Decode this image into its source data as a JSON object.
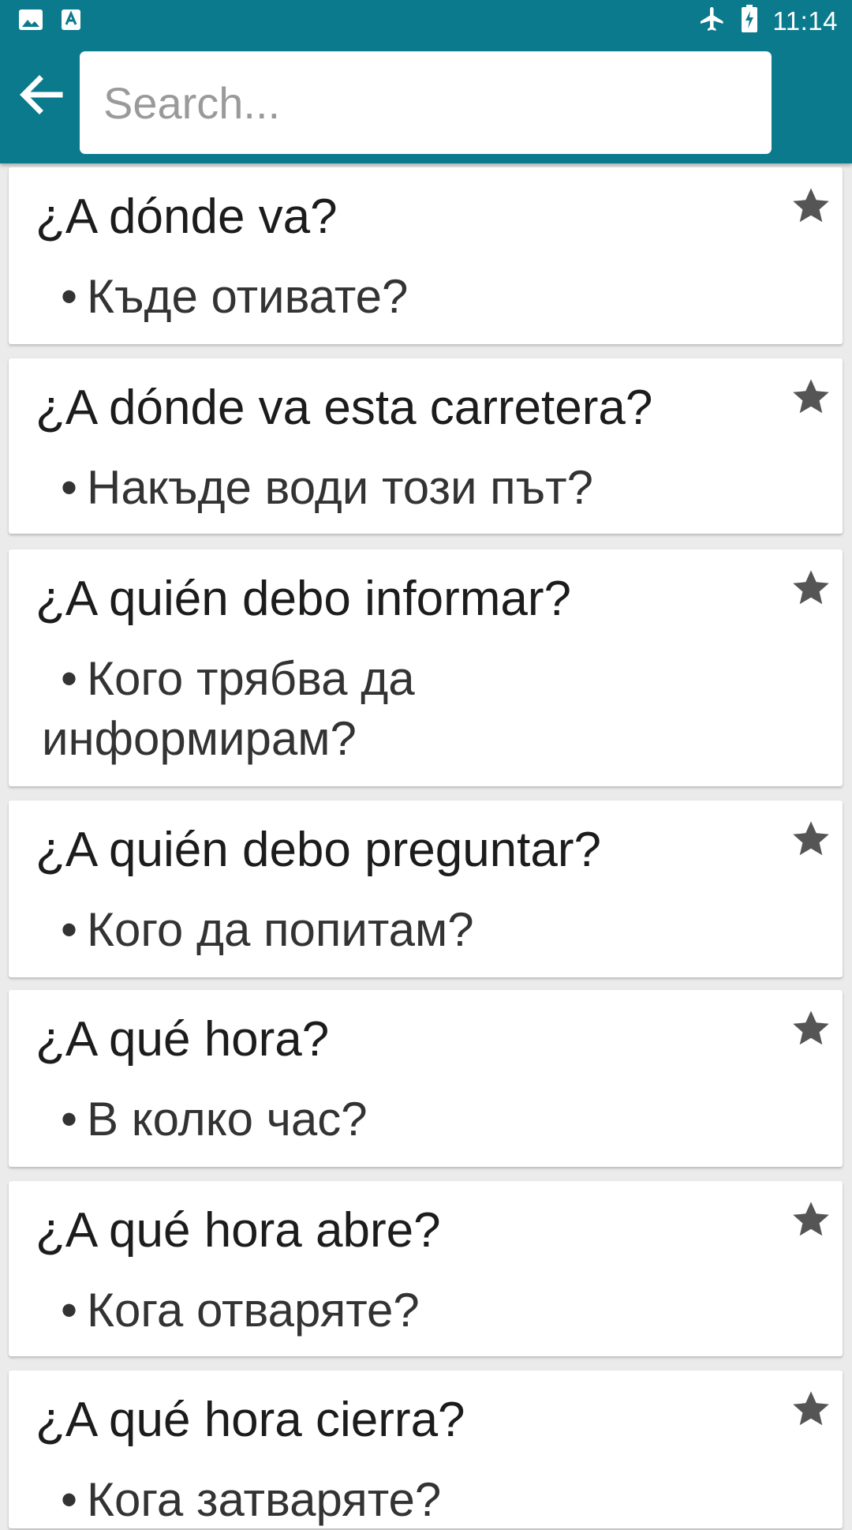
{
  "status_bar": {
    "time": "11:14",
    "icons": [
      "image-icon",
      "text-a-icon",
      "airplane-icon",
      "battery-charging-icon"
    ]
  },
  "app_bar": {
    "back_icon": "arrow-left-icon",
    "search": {
      "placeholder": "Search...",
      "value": ""
    }
  },
  "colors": {
    "primary": "#0b7a8c",
    "card_background": "#ffffff",
    "page_background": "#ebebeb",
    "star": "#555555"
  },
  "phrases": [
    {
      "spanish": "¿A dónde va?",
      "bulgarian": "Къде отивате?",
      "favorite_icon": "star-icon"
    },
    {
      "spanish": "¿A dónde va esta carretera?",
      "bulgarian": "Накъде води този път?",
      "favorite_icon": "star-icon"
    },
    {
      "spanish": "¿A quién debo informar?",
      "bulgarian": "Кого трябва да информирам?",
      "favorite_icon": "star-icon"
    },
    {
      "spanish": "¿A quién debo preguntar?",
      "bulgarian": "Кого да попитам?",
      "favorite_icon": "star-icon"
    },
    {
      "spanish": "¿A qué hora?",
      "bulgarian": "В колко час?",
      "favorite_icon": "star-icon"
    },
    {
      "spanish": "¿A qué hora abre?",
      "bulgarian": "Кога отваряте?",
      "favorite_icon": "star-icon"
    },
    {
      "spanish": "¿A qué hora cierra?",
      "bulgarian": "Кога затваряте?",
      "favorite_icon": "star-icon"
    }
  ]
}
